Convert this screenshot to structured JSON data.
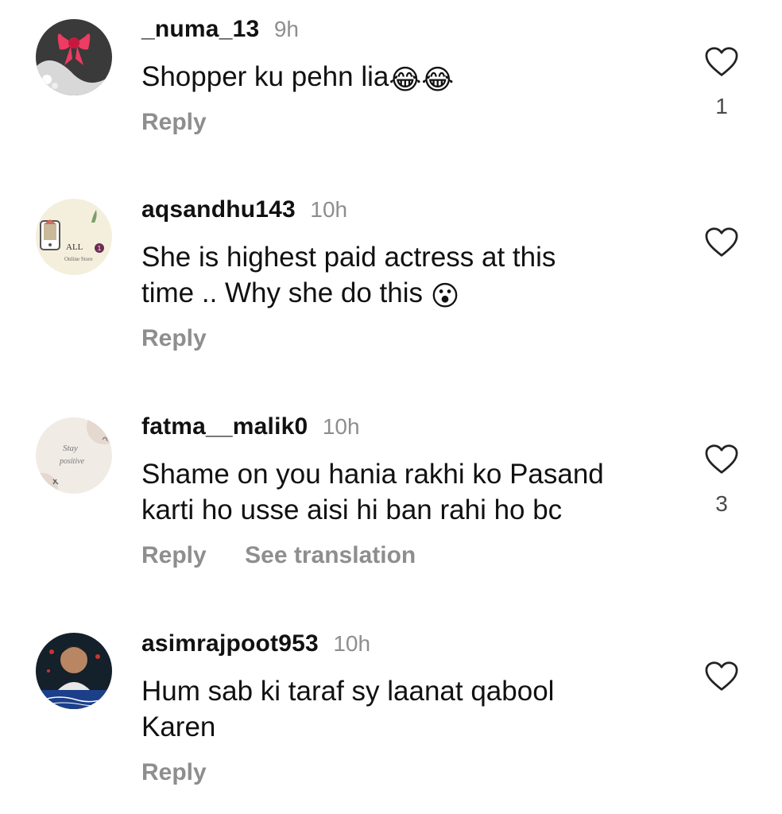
{
  "comments": [
    {
      "username": "_numa_13",
      "time": "9h",
      "text": "Shopper ku pehn lia",
      "emoji": "😂😂",
      "reply": "Reply",
      "likes": "1"
    },
    {
      "username": "aqsandhu143",
      "time": "10h",
      "text_line1": "She is highest paid actress at this",
      "text_line2": "time .. Why she do this",
      "emoji": "😮",
      "reply": "Reply",
      "avatar_text": "ALL",
      "avatar_badge": "1",
      "avatar_subtext": "Online Store"
    },
    {
      "username": "fatma__malik0",
      "time": "10h",
      "text_line1": "Shame on you hania rakhi ko Pasand",
      "text_line2": "karti ho usse aisi hi ban rahi ho bc",
      "reply": "Reply",
      "translate": "See translation",
      "likes": "3",
      "avatar_text1": "Stay",
      "avatar_text2": "positive"
    },
    {
      "username": "asimrajpoot953",
      "time": "10h",
      "text_line1": "Hum sab ki taraf sy laanat qabool",
      "text_line2": "Karen",
      "reply": "Reply"
    }
  ],
  "colors": {
    "text": "#111111",
    "muted": "#8e8e8e",
    "count": "#4a4a4a",
    "background": "#ffffff"
  },
  "icons": {
    "like": "heart-outline-icon"
  }
}
